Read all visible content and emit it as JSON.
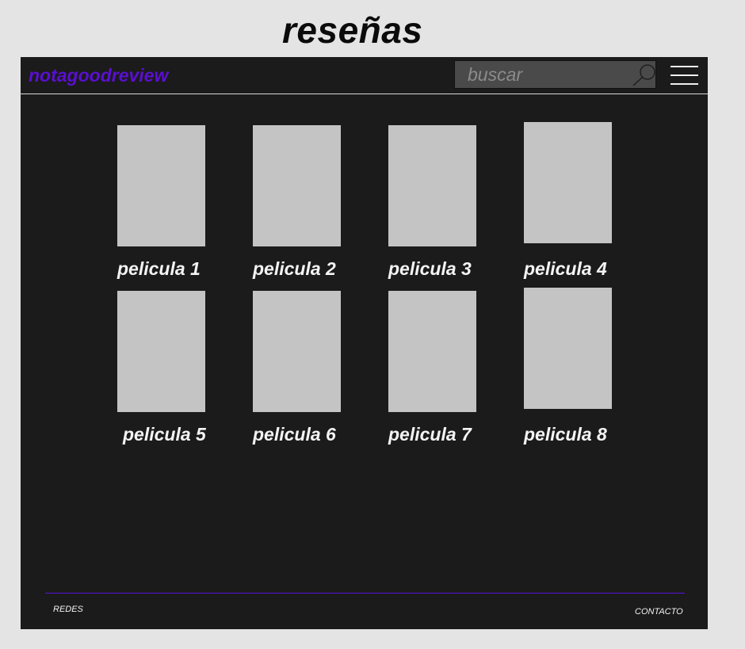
{
  "page": {
    "title": "reseñas"
  },
  "header": {
    "logo": "notagoodreview",
    "search_placeholder": "buscar"
  },
  "movies": [
    {
      "label": "pelicula 1"
    },
    {
      "label": "pelicula 2"
    },
    {
      "label": "pelicula 3"
    },
    {
      "label": "pelicula 4"
    },
    {
      "label": "pelicula 5"
    },
    {
      "label": "pelicula 6"
    },
    {
      "label": "pelicula 7"
    },
    {
      "label": "pelicula 8"
    }
  ],
  "footer": {
    "left_link": "REDES",
    "right_link": "CONTACTO"
  },
  "colors": {
    "page_background": "#e4e4e4",
    "frame_background": "#1b1b1b",
    "brand": "#5a0fd0",
    "poster_placeholder": "#c4c4c4",
    "footer_rule": "#5a12d8"
  },
  "icons": {
    "search": "search-icon",
    "menu": "hamburger-menu-icon"
  }
}
